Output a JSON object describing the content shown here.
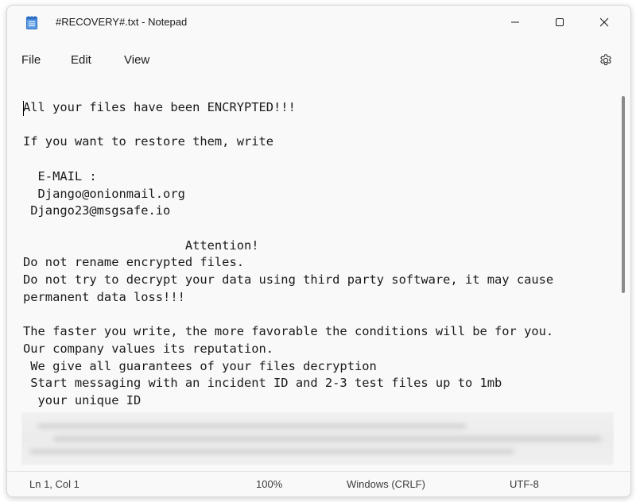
{
  "window": {
    "title": "#RECOVERY#.txt - Notepad"
  },
  "menu": {
    "file": "File",
    "edit": "Edit",
    "view": "View"
  },
  "editor": {
    "content": "All your files have been ENCRYPTED!!!\n\nIf you want to restore them, write\n\n  E-MAIL :\n  Django@onionmail.org\n Django23@msgsafe.io\n\n                      Attention!\nDo not rename encrypted files.\nDo not try to decrypt your data using third party software, it may cause\npermanent data loss!!!\n\nThe faster you write, the more favorable the conditions will be for you.\nOur company values its reputation.\n We give all guarantees of your files decryption\n Start messaging with an incident ID and 2-3 test files up to 1mb\n  your unique ID"
  },
  "status": {
    "position": "Ln 1, Col 1",
    "zoom": "100%",
    "line_ending": "Windows (CRLF)",
    "encoding": "UTF-8"
  },
  "icons": {
    "app": "notepad-icon",
    "minimize": "minimize-icon",
    "maximize": "maximize-icon",
    "close": "close-icon",
    "settings": "gear-icon"
  },
  "colors": {
    "window_bg": "#f9f9f9",
    "text": "#1a1a1a",
    "app_icon_blue": "#3a7bd5"
  }
}
